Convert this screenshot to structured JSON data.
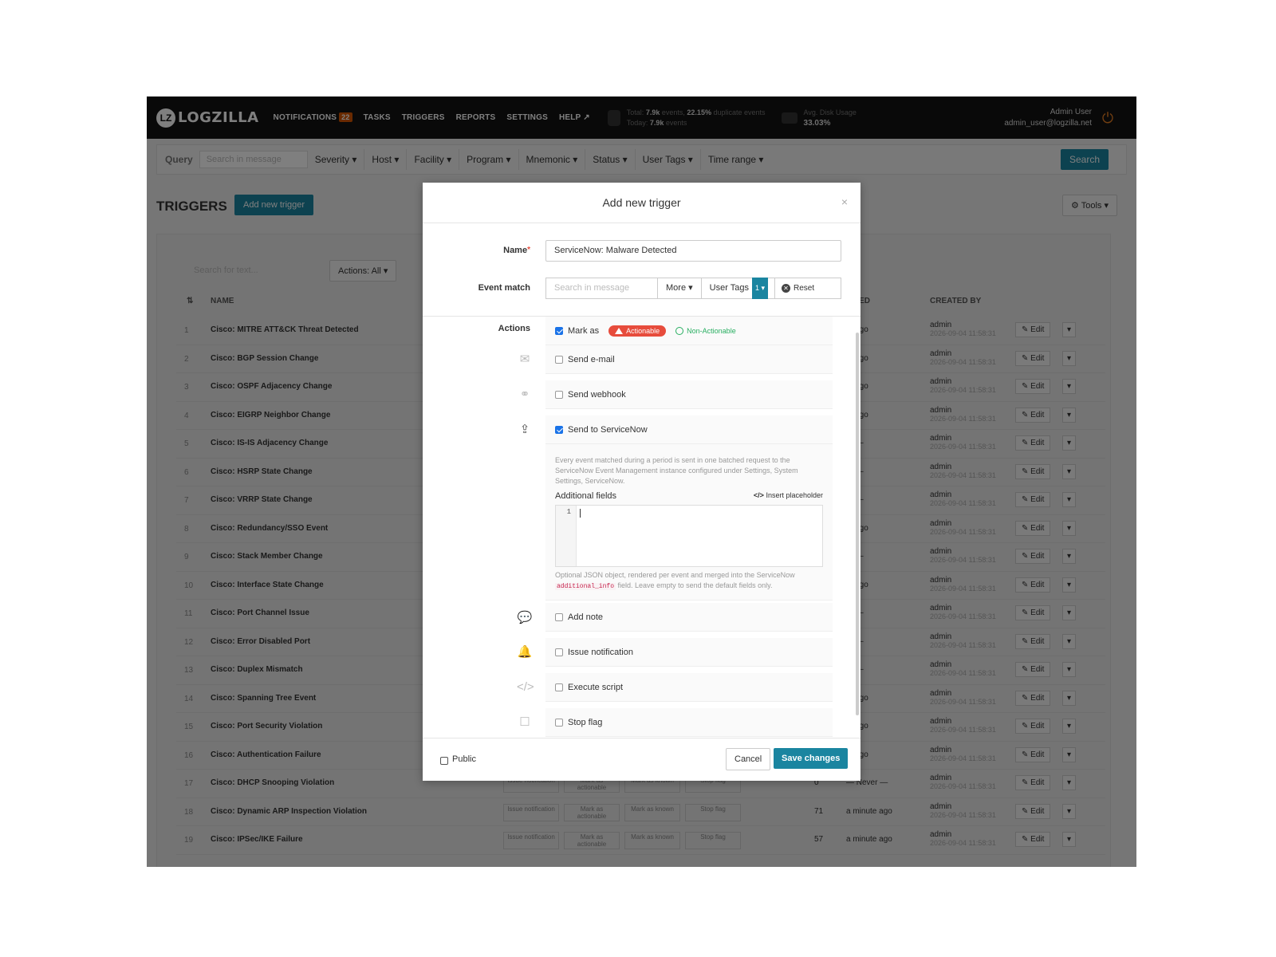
{
  "topbar": {
    "logo_mark": "LZ",
    "logo_text": "LOGZILLA",
    "nav": [
      {
        "label": "NOTIFICATIONS",
        "badge": "22"
      },
      {
        "label": "TASKS"
      },
      {
        "label": "TRIGGERS"
      },
      {
        "label": "REPORTS"
      },
      {
        "label": "SETTINGS"
      },
      {
        "label": "HELP ↗"
      }
    ],
    "stats": {
      "total_label": "Total:",
      "total_events": "7.9k",
      "total_events_suffix": "events,",
      "duplicate_pct": "22.15%",
      "duplicate_suffix": "duplicate events",
      "today_label": "Today:",
      "today_events": "7.9k",
      "today_suffix": "events"
    },
    "disk": {
      "label": "Avg. Disk Usage",
      "value": "33.03%"
    },
    "user": {
      "name": "Admin User",
      "email": "admin_user@logzilla.net"
    }
  },
  "querybar": {
    "label": "Query",
    "placeholder": "Search in message",
    "filters": [
      "Severity",
      "Host",
      "Facility",
      "Program",
      "Mnemonic",
      "Status",
      "User Tags",
      "Time range"
    ],
    "search_label": "Search"
  },
  "page": {
    "title": "TRIGGERS",
    "add_label": "Add new trigger",
    "tools_label": "Tools",
    "search_placeholder": "Search for text...",
    "actions_filter": "Actions: All",
    "col_name": "NAME",
    "col_fired": "FIRED",
    "col_created": "CREATED BY",
    "edit_label": "Edit"
  },
  "rows": [
    {
      "num": "1",
      "name": "Cisco: MITRE ATT&CK Threat Detected",
      "ago": "te ago",
      "by": "admin",
      "date": "2026-09-04 11:58:31"
    },
    {
      "num": "2",
      "name": "Cisco: BGP Session Change",
      "ago": "te ago",
      "by": "admin",
      "date": "2026-09-04 11:58:31"
    },
    {
      "num": "3",
      "name": "Cisco: OSPF Adjacency Change",
      "ago": "te ago",
      "by": "admin",
      "date": "2026-09-04 11:58:31"
    },
    {
      "num": "4",
      "name": "Cisco: EIGRP Neighbor Change",
      "ago": "te ago",
      "by": "admin",
      "date": "2026-09-04 11:58:31"
    },
    {
      "num": "5",
      "name": "Cisco: IS-IS Adjacency Change",
      "ago": "er —",
      "by": "admin",
      "date": "2026-09-04 11:58:31"
    },
    {
      "num": "6",
      "name": "Cisco: HSRP State Change",
      "ago": "er —",
      "by": "admin",
      "date": "2026-09-04 11:58:31"
    },
    {
      "num": "7",
      "name": "Cisco: VRRP State Change",
      "ago": "er —",
      "by": "admin",
      "date": "2026-09-04 11:58:31"
    },
    {
      "num": "8",
      "name": "Cisco: Redundancy/SSO Event",
      "ago": "te ago",
      "by": "admin",
      "date": "2026-09-04 11:58:31"
    },
    {
      "num": "9",
      "name": "Cisco: Stack Member Change",
      "ago": "er —",
      "by": "admin",
      "date": "2026-09-04 11:58:31"
    },
    {
      "num": "10",
      "name": "Cisco: Interface State Change",
      "ago": "te ago",
      "by": "admin",
      "date": "2026-09-04 11:58:31"
    },
    {
      "num": "11",
      "name": "Cisco: Port Channel Issue",
      "ago": "er —",
      "by": "admin",
      "date": "2026-09-04 11:58:31"
    },
    {
      "num": "12",
      "name": "Cisco: Error Disabled Port",
      "ago": "er —",
      "by": "admin",
      "date": "2026-09-04 11:58:31"
    },
    {
      "num": "13",
      "name": "Cisco: Duplex Mismatch",
      "ago": "er —",
      "by": "admin",
      "date": "2026-09-04 11:58:31"
    },
    {
      "num": "14",
      "name": "Cisco: Spanning Tree Event",
      "ago": "te ago",
      "by": "admin",
      "date": "2026-09-04 11:58:31"
    },
    {
      "num": "15",
      "name": "Cisco: Port Security Violation",
      "ago": "te ago",
      "by": "admin",
      "date": "2026-09-04 11:58:31"
    },
    {
      "num": "16",
      "name": "Cisco: Authentication Failure",
      "ago": "te ago",
      "by": "admin",
      "date": "2026-09-04 11:58:31"
    },
    {
      "num": "17",
      "name": "Cisco: DHCP Snooping Violation",
      "count": "0",
      "ago": "— Never —",
      "by": "admin",
      "date": "2026-09-04 11:58:31",
      "acts": [
        "Issue notification",
        "Mark as actionable",
        "Mark as known",
        "Stop flag"
      ]
    },
    {
      "num": "18",
      "name": "Cisco: Dynamic ARP Inspection Violation",
      "count": "71",
      "ago": "a minute ago",
      "by": "admin",
      "date": "2026-09-04 11:58:31",
      "acts": [
        "Issue notification",
        "Mark as actionable",
        "Mark as known",
        "Stop flag"
      ]
    },
    {
      "num": "19",
      "name": "Cisco: IPSec/IKE Failure",
      "count": "57",
      "ago": "a minute ago",
      "by": "admin",
      "date": "2026-09-04 11:58:31",
      "acts": [
        "Issue notification",
        "Mark as actionable",
        "Mark as known",
        "Stop flag"
      ]
    }
  ],
  "modal": {
    "title": "Add new trigger",
    "close": "×",
    "name_label": "Name",
    "name_required": "*",
    "name_value": "ServiceNow: Malware Detected",
    "event_match_label": "Event match",
    "em_placeholder": "Search in message",
    "em_more": "More",
    "em_user_tags": "User Tags",
    "em_user_tags_count": "1",
    "em_reset": "Reset",
    "actions_label": "Actions",
    "mark_as": "Mark as",
    "actionable": "Actionable",
    "non_actionable": "Non-Actionable",
    "send_email": "Send e-mail",
    "send_webhook": "Send webhook",
    "send_servicenow": "Send to ServiceNow",
    "sn_desc": "Every event matched during a period is sent in one batched request to the ServiceNow Event Management instance configured under Settings, System Settings, ServiceNow.",
    "sn_fields": "Additional fields",
    "sn_insert": "Insert placeholder",
    "sn_line": "1",
    "sn_help_pre": "Optional JSON object, rendered per event and merged into the ServiceNow",
    "sn_help_code": "additional_info",
    "sn_help_post": "field. Leave empty to send the default fields only.",
    "add_note": "Add note",
    "issue_notification": "Issue notification",
    "execute_script": "Execute script",
    "stop_flag": "Stop flag",
    "public": "Public",
    "cancel": "Cancel",
    "save": "Save changes"
  },
  "colors": {
    "accent": "#1a85a0",
    "danger": "#e74c3c",
    "success": "#27ae60",
    "nav_bg": "#121212"
  }
}
